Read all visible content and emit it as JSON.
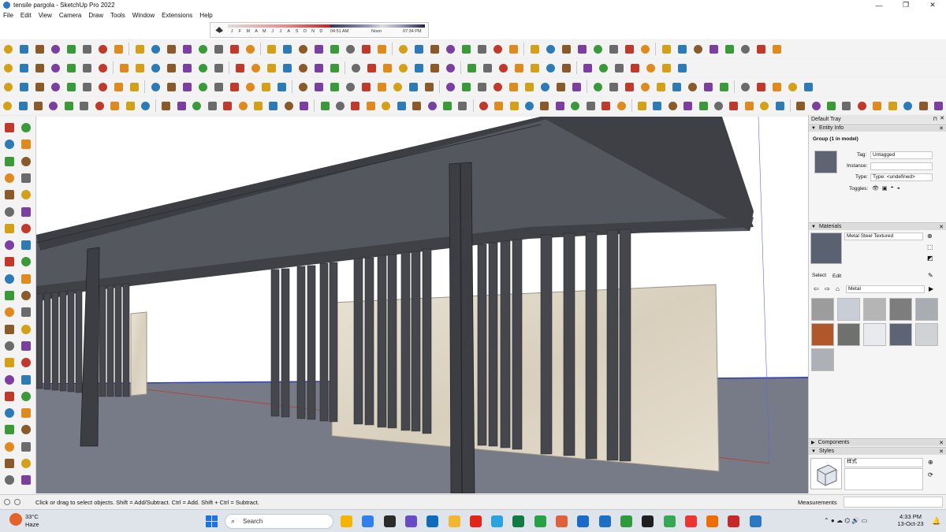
{
  "window": {
    "title": "tensile pargola - SketchUp Pro 2022",
    "controls": [
      "—",
      "❐",
      "✕"
    ]
  },
  "menu": [
    "File",
    "Edit",
    "View",
    "Camera",
    "Draw",
    "Tools",
    "Window",
    "Extensions",
    "Help"
  ],
  "shadow_settings": {
    "months": [
      "J",
      "F",
      "M",
      "A",
      "M",
      "J",
      "J",
      "A",
      "S",
      "O",
      "N",
      "D"
    ],
    "sunrise": "04:51 AM",
    "noon": "Noon",
    "sunset": "07:34 PM"
  },
  "toolbar_colors": [
    "#c0392b",
    "#2c7bb6",
    "#3a9a3a",
    "#e08a1e",
    "#8a5a2b",
    "#6b6b6b",
    "#d4a017",
    "#7a3fa0"
  ],
  "tray": {
    "title": "Default Tray",
    "entity_info": {
      "header": "Entity Info",
      "selection": "Group (1 in model)",
      "tag_label": "Tag:",
      "tag_value": "Untagged",
      "instance_label": "Instance:",
      "instance_value": "",
      "type_label": "Type:",
      "type_value": "Type: <undefined>",
      "toggles_label": "Toggles:"
    },
    "materials": {
      "header": "Materials",
      "current": "Metal Steel Textured",
      "tab_select": "Select",
      "tab_edit": "Edit",
      "library": "Metal",
      "swatch_colors": [
        "#9c9c9c",
        "#c9ced6",
        "#b5b5b5",
        "#7d7d7d",
        "#a9acb1",
        "#b0582c",
        "#6f716f",
        "#e9eaee",
        "#5d6475",
        "#d0d2d6",
        "#adb1b5"
      ]
    },
    "components": {
      "header": "Components"
    },
    "styles": {
      "header": "Styles",
      "current": "样式"
    }
  },
  "status": {
    "message": "Click or drag to select objects. Shift = Add/Subtract. Ctrl = Add. Shift + Ctrl = Subtract.",
    "measurements_label": "Measurements",
    "measurements_value": ""
  },
  "taskbar": {
    "temperature": "33°C",
    "condition": "Haze",
    "search_placeholder": "Search",
    "time": "4:33 PM",
    "date": "13-Oct-23",
    "app_colors": [
      "#f4b400",
      "#2f80ed",
      "#2b2b2b",
      "#6a4bc4",
      "#0f6cbd",
      "#f2b632",
      "#e1251b",
      "#2aa3e0",
      "#107c41",
      "#27a046",
      "#e0603b",
      "#1b6ac9",
      "#1e6fc4",
      "#2f9a3b",
      "#1f1f1f",
      "#34a853",
      "#e33",
      "#ef6c00",
      "#c62828",
      "#2b79c2"
    ]
  }
}
